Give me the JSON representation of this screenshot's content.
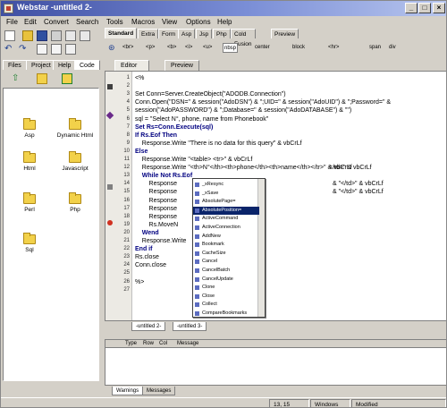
{
  "window": {
    "title": "Webstar  -untitled 2-"
  },
  "menu": [
    "File",
    "Edit",
    "Convert",
    "Search",
    "Tools",
    "Macros",
    "View",
    "Options",
    "Help"
  ],
  "tag_tabs": [
    "Standard",
    "Extra",
    "Form",
    "Asp",
    "Jsp",
    "Php",
    "Cold Fusion",
    "Preview"
  ],
  "tag_items": [
    "<br>",
    "<p>",
    "<b>",
    "<i>",
    "<u>",
    "nbsp",
    "center",
    "block",
    "<hr>",
    "span",
    "div"
  ],
  "sidebar": {
    "tabs": [
      "Files",
      "Project",
      "Help",
      "Code"
    ],
    "folders": [
      "Asp",
      "Dynamic Html",
      "Html",
      "Javascript",
      "Perl",
      "Php",
      "Sql"
    ]
  },
  "editor": {
    "tabs": [
      "Editor Window",
      "Preview Window"
    ],
    "line_numbers": [
      "1",
      "2",
      "3",
      "4",
      "5",
      "6",
      "7",
      "8",
      "9",
      "10",
      "11",
      "12",
      "13",
      "14",
      "15",
      "16",
      "17",
      "18",
      "19",
      "20",
      "21",
      "22",
      "23",
      "24",
      "25",
      "26",
      "27"
    ],
    "lines": [
      "<%",
      "",
      "Set Conn=Server.CreateObject(\"ADODB.Connection\")",
      "Conn.Open(\"DSN=\" & session(\"AdoDSN\") & \";UID=\" & session(\"AdoUID\") & \";Password=\" &",
      "session(\"AdoPASSWORD\") & \";Database=\" & session(\"AdoDATABASE\") & \"\")",
      "sql = \"Select N°, phone, name from Phonebook\"",
      "Set Rs=Conn.Execute(sql)",
      "If Rs.Eof Then",
      "    Response.Write \"There is no data for this query\" & vbCrLf",
      "Else",
      "    Response.Write \"<table> <tr>\" & vbCrLf",
      "    Response.Write \"<th>N°</th><th>phone</th><th>name</th></tr>\" & vbCrLf",
      "    While Not Rs.Eof",
      "        Response",
      "        Response",
      "        Response",
      "        Response",
      "        Response",
      "        Rs.MoveN",
      "    Wend",
      "    Response.Write",
      "End if",
      "Rs.close",
      "Conn.close",
      "",
      "%>",
      ""
    ],
    "tails": [
      "</td>\" & vbCrLf",
      "& \"</td>\" & vbCrLf",
      "& \"</td>\" & vbCrLf"
    ]
  },
  "autocomplete": {
    "items": [
      "_xResync",
      "_xSave",
      "AbsolutePage=",
      "AbsolutePosition=",
      "ActiveCommand",
      "ActiveConnection",
      "AddNew",
      "Bookmark",
      "CacheSize",
      "Cancel",
      "CancelBatch",
      "CancelUpdate",
      "Clone",
      "Close",
      "Collect",
      "CompareBookmarks"
    ],
    "selected": "AbsolutePosition="
  },
  "doc_tabs": [
    "-untitled 2-",
    "-untitled 3-"
  ],
  "messages": {
    "columns": [
      "Type",
      "Row",
      "Col",
      "Message"
    ],
    "tabs": [
      "Warnings",
      "Messages"
    ]
  },
  "status": {
    "position": "13, 15",
    "format": "Windows",
    "state": "Modified"
  },
  "colors": {
    "title_start": "#3f4fa3",
    "selection": "#0a246a",
    "keyword": "#000080",
    "string": "#800000"
  }
}
